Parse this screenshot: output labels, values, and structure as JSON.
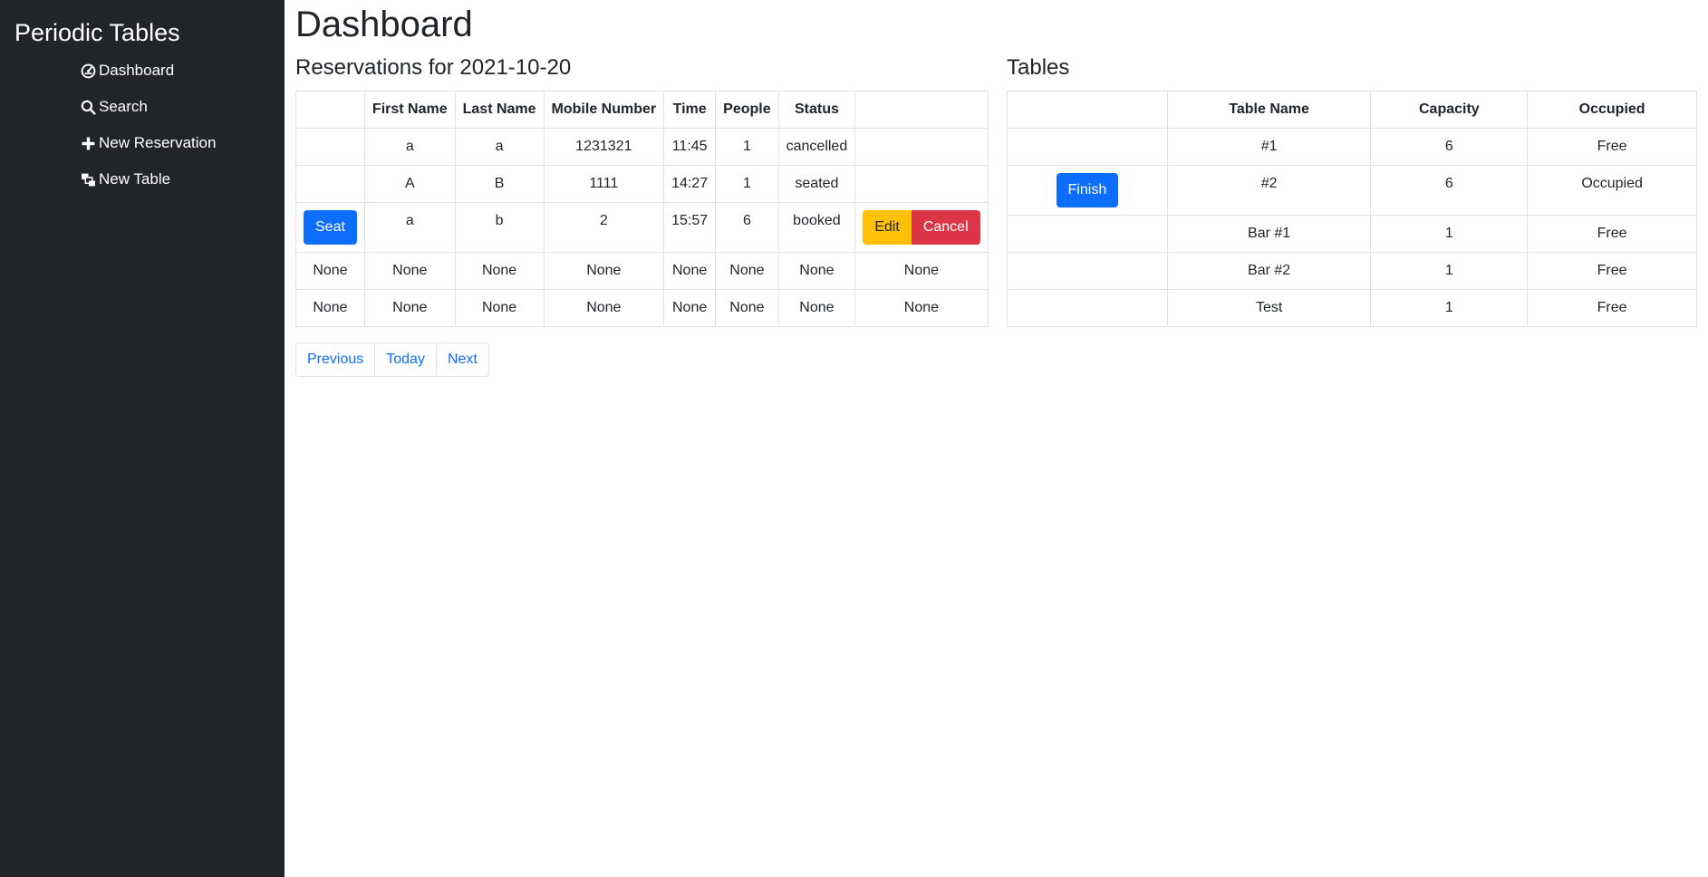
{
  "sidebar": {
    "brand": "Periodic Tables",
    "items": [
      {
        "label": "Dashboard",
        "icon": "dashboard-icon"
      },
      {
        "label": "Search",
        "icon": "search-icon"
      },
      {
        "label": "New Reservation",
        "icon": "plus-icon"
      },
      {
        "label": "New Table",
        "icon": "layers-icon"
      }
    ]
  },
  "main": {
    "title": "Dashboard",
    "reservations": {
      "heading": "Reservations for 2021-10-20",
      "columns": [
        "",
        "First Name",
        "Last Name",
        "Mobile Number",
        "Time",
        "People",
        "Status",
        ""
      ],
      "rows": [
        {
          "first": "a",
          "last": "a",
          "mobile": "1231321",
          "time": "11:45",
          "people": "1",
          "status": "cancelled"
        },
        {
          "first": "A",
          "last": "B",
          "mobile": "1111",
          "time": "14:27",
          "people": "1",
          "status": "seated"
        },
        {
          "seat": "Seat",
          "first": "a",
          "last": "b",
          "mobile": "2",
          "time": "15:57",
          "people": "6",
          "status": "booked",
          "edit": "Edit",
          "cancel": "Cancel"
        },
        {
          "c0": "None",
          "first": "None",
          "last": "None",
          "mobile": "None",
          "time": "None",
          "people": "None",
          "status": "None",
          "c7": "None"
        },
        {
          "c0": "None",
          "first": "None",
          "last": "None",
          "mobile": "None",
          "time": "None",
          "people": "None",
          "status": "None",
          "c7": "None"
        }
      ]
    },
    "pagination": {
      "previous": "Previous",
      "today": "Today",
      "next": "Next"
    },
    "tables": {
      "heading": "Tables",
      "columns": [
        "",
        "Table Name",
        "Capacity",
        "Occupied"
      ],
      "rows": [
        {
          "name": "#1",
          "capacity": "6",
          "occupied": "Free"
        },
        {
          "action": "Finish",
          "name": "#2",
          "capacity": "6",
          "occupied": "Occupied"
        },
        {
          "name": "Bar #1",
          "capacity": "1",
          "occupied": "Free"
        },
        {
          "name": "Bar #2",
          "capacity": "1",
          "occupied": "Free"
        },
        {
          "name": "Test",
          "capacity": "1",
          "occupied": "Free"
        }
      ]
    }
  },
  "colors": {
    "sidebar_bg": "#212529",
    "primary": "#0d6efd",
    "warning": "#ffc107",
    "danger": "#dc3545",
    "border": "#dee2e6"
  }
}
